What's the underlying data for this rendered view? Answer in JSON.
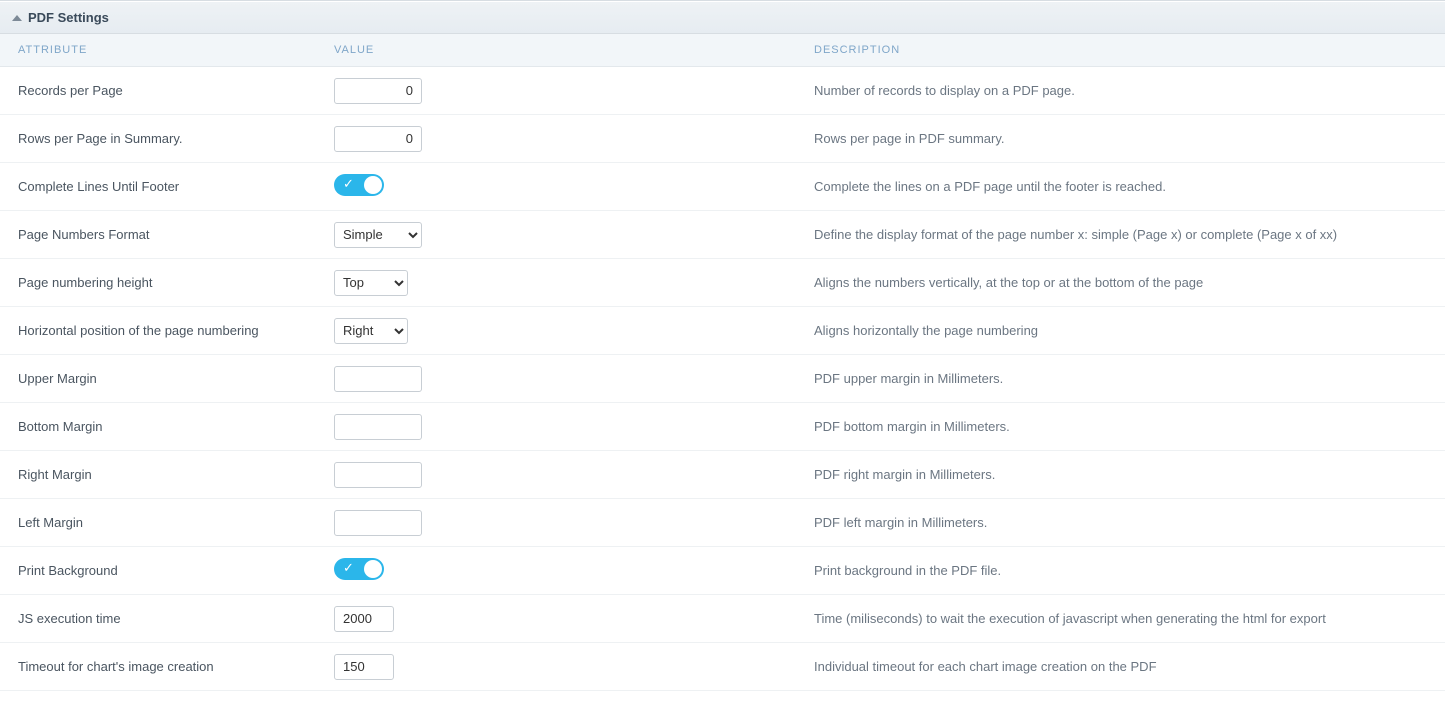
{
  "panel": {
    "title": "PDF Settings"
  },
  "headers": {
    "attribute": "ATTRIBUTE",
    "value": "VALUE",
    "description": "DESCRIPTION"
  },
  "rows": {
    "records_per_page": {
      "label": "Records per Page",
      "value": "0",
      "desc": "Number of records to display on a PDF page."
    },
    "rows_per_page_sum": {
      "label": "Rows per Page in Summary.",
      "value": "0",
      "desc": "Rows per page in PDF summary."
    },
    "complete_lines": {
      "label": "Complete Lines Until Footer",
      "on": true,
      "desc": "Complete the lines on a PDF page until the footer is reached."
    },
    "page_num_format": {
      "label": "Page Numbers Format",
      "value": "Simple",
      "desc": "Define the display format of the page number x: simple (Page x) or complete (Page x of xx)"
    },
    "page_num_height": {
      "label": "Page numbering height",
      "value": "Top",
      "desc": "Aligns the numbers vertically, at the top or at the bottom of the page"
    },
    "page_num_hpos": {
      "label": "Horizontal position of the page numbering",
      "value": "Right",
      "desc": "Aligns horizontally the page numbering"
    },
    "upper_margin": {
      "label": "Upper Margin",
      "value": "",
      "desc": "PDF upper margin in Millimeters."
    },
    "bottom_margin": {
      "label": "Bottom Margin",
      "value": "",
      "desc": "PDF bottom margin in Millimeters."
    },
    "right_margin": {
      "label": "Right Margin",
      "value": "",
      "desc": "PDF right margin in Millimeters."
    },
    "left_margin": {
      "label": "Left Margin",
      "value": "",
      "desc": "PDF left margin in Millimeters."
    },
    "print_background": {
      "label": "Print Background",
      "on": true,
      "desc": "Print background in the PDF file."
    },
    "js_exec_time": {
      "label": "JS execution time",
      "value": "2000",
      "desc": "Time (miliseconds) to wait the execution of javascript when generating the html for export"
    },
    "chart_timeout": {
      "label": "Timeout for chart's image creation",
      "value": "150",
      "desc": "Individual timeout for each chart image creation on the PDF"
    }
  }
}
